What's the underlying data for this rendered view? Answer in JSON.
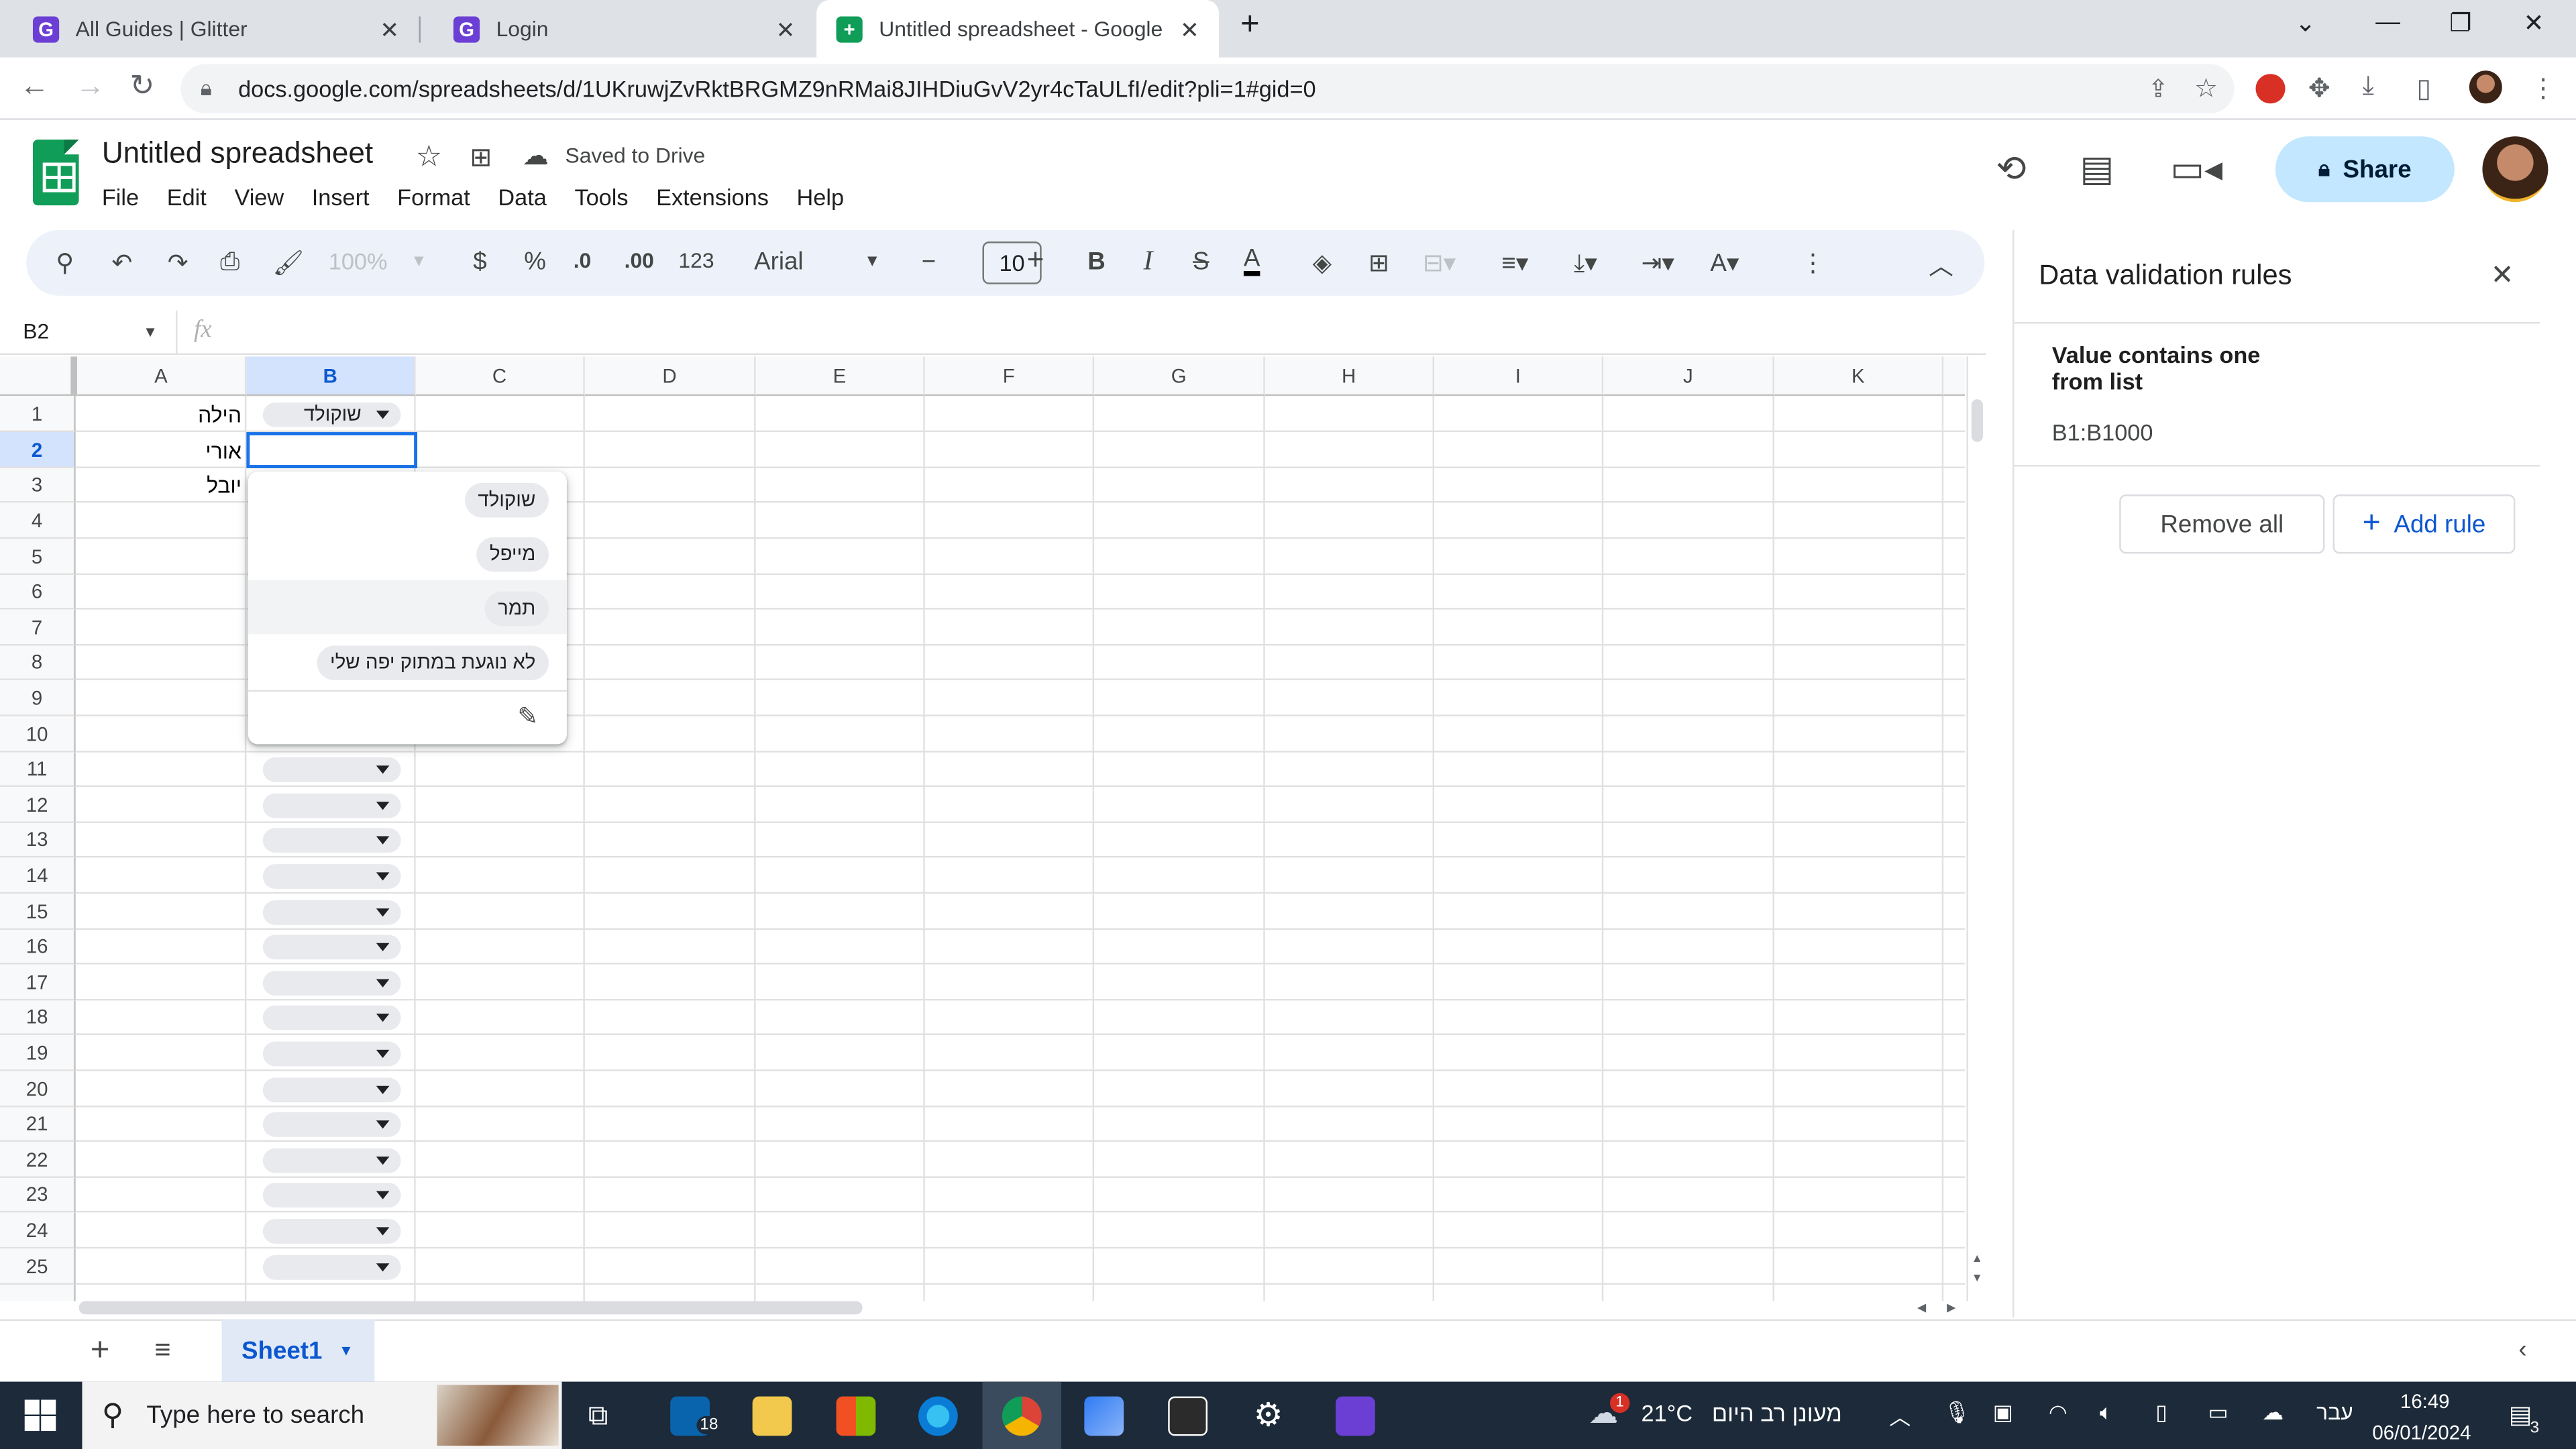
{
  "browser": {
    "tabs": [
      {
        "title": "All Guides | Glitter"
      },
      {
        "title": "Login"
      },
      {
        "title": "Untitled spreadsheet - Google Sh"
      }
    ],
    "url": "docs.google.com/spreadsheets/d/1UKruwjZvRktBRGMZ9nRMai8JIHDiuGvV2yr4cTaULfI/edit?pli=1#gid=0"
  },
  "doc": {
    "title": "Untitled spreadsheet",
    "saved_status": "Saved to Drive",
    "menu": [
      "File",
      "Edit",
      "View",
      "Insert",
      "Format",
      "Data",
      "Tools",
      "Extensions",
      "Help"
    ],
    "share_label": "Share"
  },
  "toolbar": {
    "zoom": "100%",
    "currency": "$",
    "percent": "%",
    "decimal_decrease": ".0",
    "decimal_increase": ".00",
    "format_123": "123",
    "font": "Arial",
    "font_size": "10",
    "bold": "B",
    "italic": "I",
    "text_color_letter": "A"
  },
  "formula_bar": {
    "name_box": "B2",
    "fx": "fx"
  },
  "grid": {
    "columns": [
      "A",
      "B",
      "C",
      "D",
      "E",
      "F",
      "G",
      "H",
      "I",
      "J",
      "K"
    ],
    "rows": [
      "1",
      "2",
      "3",
      "4",
      "5",
      "6",
      "7",
      "8",
      "9",
      "10",
      "11",
      "12",
      "13",
      "14",
      "15",
      "16",
      "17",
      "18",
      "19",
      "20",
      "21",
      "22",
      "23",
      "24",
      "25"
    ],
    "col_a_values": [
      "הילה",
      "אורי",
      "יובל"
    ],
    "b1_value": "שוקולד"
  },
  "dropdown": {
    "options": [
      "שוקולד",
      "מייפל",
      "תמר",
      "לא נוגעת במתוק יפה שלי"
    ],
    "highlighted": "תמר"
  },
  "panel": {
    "title": "Data validation rules",
    "rule_title": "Value contains one from list",
    "rule_range": "B1:B1000",
    "remove_all": "Remove all",
    "add_rule": "Add rule"
  },
  "sheet_tab": "Sheet1",
  "taskbar": {
    "search_placeholder": "Type here to search",
    "mail_badge": "18",
    "weather_temp": "21°C",
    "weather_text": "מעונן רב היום",
    "weather_badge": "1",
    "language": "עבר",
    "time": "16:49",
    "date": "06/01/2024",
    "notif_count": "3"
  },
  "colors": {
    "sheets_green": "#0f9d58",
    "selection_blue": "#1a73e8",
    "share_bg": "#c2e7ff",
    "taskbar_bg": "#1c2a3a"
  }
}
